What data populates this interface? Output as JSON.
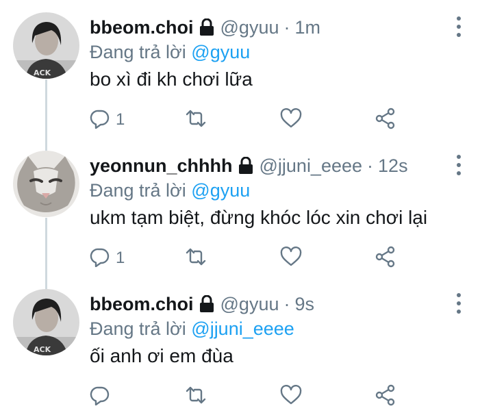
{
  "tweets": [
    {
      "display_name": "bbeom.choi",
      "handle": "@gyuu",
      "separator": "·",
      "time": "1m",
      "reply_prefix": "Đang trả lời",
      "reply_to": "@gyuu",
      "text": "bo xì đi kh chơi lữa",
      "reply_count": "1",
      "avatar": "person-photo"
    },
    {
      "display_name": "yeonnun_chhhh",
      "handle": "@jjuni_eeee",
      "separator": "·",
      "time": "12s",
      "reply_prefix": "Đang trả lời",
      "reply_to": "@gyuu",
      "text": "ukm tạm biệt, đừng khóc lóc xin chơi lại",
      "reply_count": "1",
      "avatar": "cat-photo"
    },
    {
      "display_name": "bbeom.choi",
      "handle": "@gyuu",
      "separator": "·",
      "time": "9s",
      "reply_prefix": "Đang trả lời",
      "reply_to": "@jjuni_eeee",
      "text": "ối anh ơi em đùa",
      "reply_count": "",
      "avatar": "person-photo"
    }
  ],
  "icons": {
    "lock": "lock-icon",
    "reply": "reply-icon",
    "retweet": "retweet-icon",
    "like": "heart-icon",
    "share": "share-icon",
    "more": "more-vertical-icon"
  },
  "colors": {
    "text": "#14171a",
    "secondary": "#657786",
    "mention": "#1da1f2",
    "thread_line": "#cfd9de"
  }
}
